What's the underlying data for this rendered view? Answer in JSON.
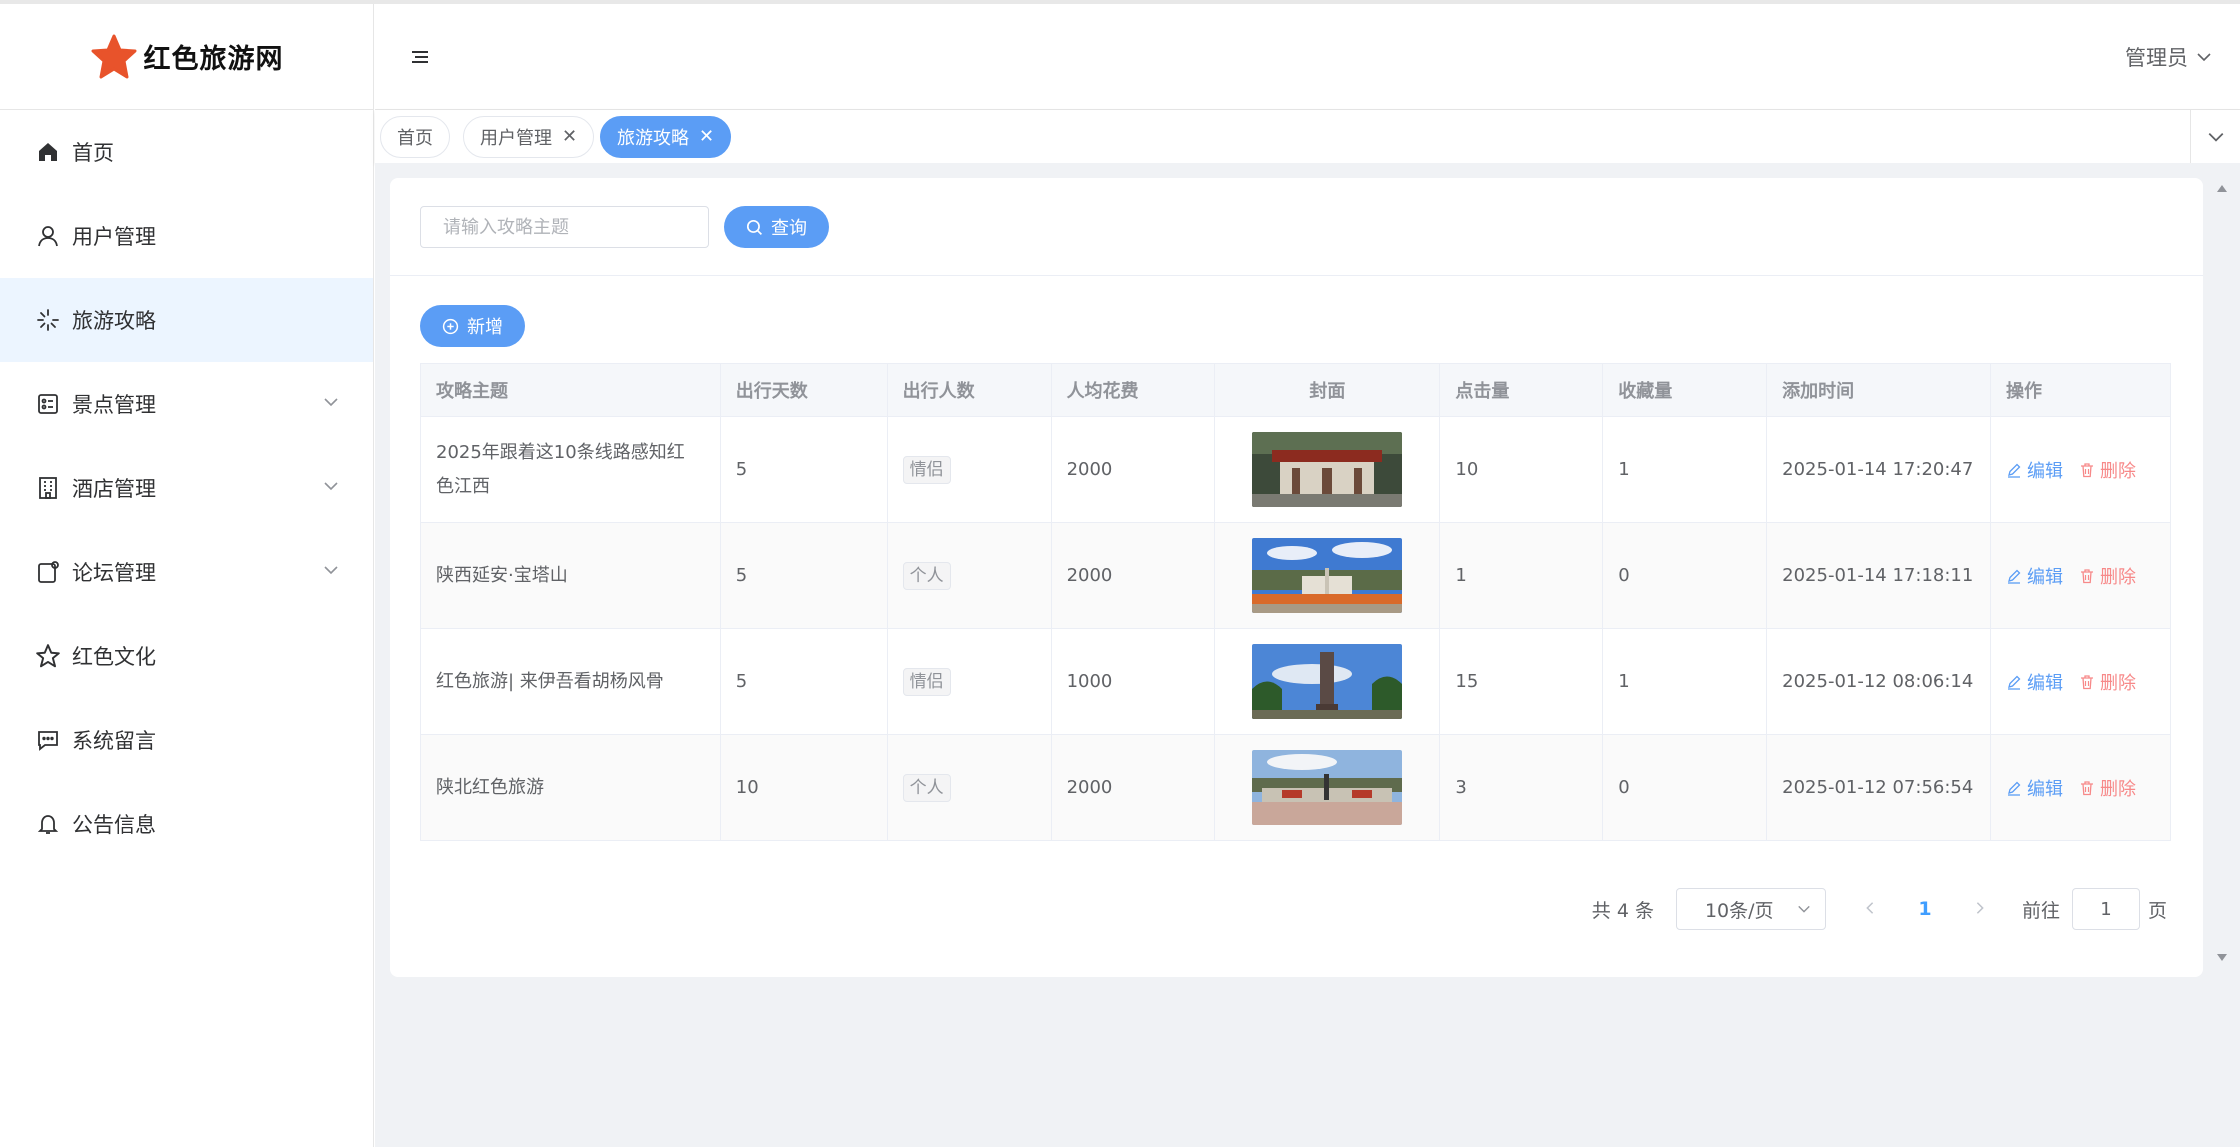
{
  "app": {
    "name": "红色旅游网"
  },
  "sidebar": {
    "items": [
      {
        "label": "首页",
        "icon": "home-icon"
      },
      {
        "label": "用户管理",
        "icon": "user-icon"
      },
      {
        "label": "旅游攻略",
        "icon": "loading-icon",
        "active": true
      },
      {
        "label": "景点管理",
        "icon": "tickets-icon",
        "expandable": true
      },
      {
        "label": "酒店管理",
        "icon": "office-building-icon",
        "expandable": true
      },
      {
        "label": "论坛管理",
        "icon": "notebook-icon",
        "expandable": true
      },
      {
        "label": "红色文化",
        "icon": "star-icon"
      },
      {
        "label": "系统留言",
        "icon": "chat-icon"
      },
      {
        "label": "公告信息",
        "icon": "bell-icon"
      }
    ]
  },
  "header": {
    "user": "管理员"
  },
  "tabs": [
    {
      "label": "首页",
      "closable": false
    },
    {
      "label": "用户管理",
      "closable": true
    },
    {
      "label": "旅游攻略",
      "closable": true,
      "active": true
    }
  ],
  "search": {
    "placeholder": "请输入攻略主题",
    "value": "",
    "button": "查询"
  },
  "toolbar": {
    "add_label": "新增"
  },
  "table": {
    "columns": [
      "攻略主题",
      "出行天数",
      "出行人数",
      "人均花费",
      "封面",
      "点击量",
      "收藏量",
      "添加时间",
      "操作"
    ],
    "rows": [
      {
        "title": "2025年跟着这10条线路感知红色江西",
        "days": "5",
        "people": "情侣",
        "cost": "2000",
        "clicks": "10",
        "favorites": "1",
        "time": "2025-01-14 17:20:47"
      },
      {
        "title": "陕西延安·宝塔山",
        "days": "5",
        "people": "个人",
        "cost": "2000",
        "clicks": "1",
        "favorites": "0",
        "time": "2025-01-14 17:18:11"
      },
      {
        "title": "红色旅游| 来伊吾看胡杨风骨",
        "days": "5",
        "people": "情侣",
        "cost": "1000",
        "clicks": "15",
        "favorites": "1",
        "time": "2025-01-12 08:06:14"
      },
      {
        "title": "陕北红色旅游",
        "days": "10",
        "people": "个人",
        "cost": "2000",
        "clicks": "3",
        "favorites": "0",
        "time": "2025-01-12 07:56:54"
      }
    ],
    "edit_label": "编辑",
    "delete_label": "删除"
  },
  "pagination": {
    "total_text": "共 4 条",
    "page_size": "10条/页",
    "current_page": "1",
    "goto_prefix": "前往",
    "goto_value": "1",
    "goto_suffix": "页"
  },
  "colors": {
    "primary": "#5b9df5",
    "danger": "#f78989",
    "logo_star": "#e8532b"
  }
}
